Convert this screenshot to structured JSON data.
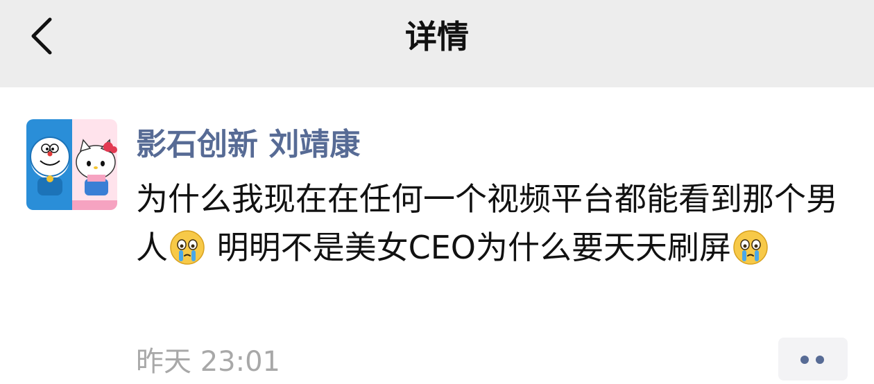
{
  "header": {
    "title": "详情",
    "back_icon": "chevron-left-icon",
    "background": "#ededed"
  },
  "post": {
    "avatar_icon": "doraemon-hello-kitty-avatar",
    "author": "影石创新 刘靖康",
    "text_parts": [
      "为什么我现在在任何一个视频平台都能看到那个男人",
      " 明明不是美女CEO为什么要天天刷屏"
    ],
    "emoji_icon": "crying-face-emoji",
    "time": "昨天 23:01",
    "more_icon": "more-dots-icon"
  },
  "colors": {
    "author": "#576b95",
    "text": "#111111",
    "time": "#a8a8a8"
  }
}
